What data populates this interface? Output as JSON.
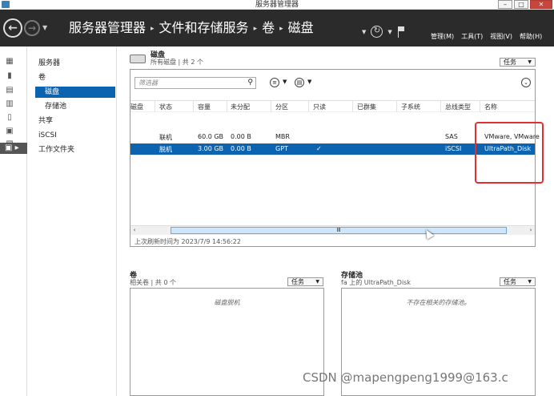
{
  "window": {
    "title": "服务器管理器"
  },
  "header": {
    "breadcrumb": [
      "服务器管理器",
      "文件和存储服务",
      "卷",
      "磁盘"
    ],
    "menus": [
      "管理(M)",
      "工具(T)",
      "视图(V)",
      "帮助(H)"
    ]
  },
  "nav": {
    "items": [
      {
        "label": "服务器"
      },
      {
        "label": "卷"
      },
      {
        "label": "磁盘"
      },
      {
        "label": "存储池"
      },
      {
        "label": "共享"
      },
      {
        "label": "iSCSI"
      },
      {
        "label": "工作文件夹"
      }
    ]
  },
  "disks": {
    "title": "磁盘",
    "subtitle": "所有磁盘 | 共 2 个",
    "tasks_label": "任务",
    "filter_placeholder": "筛选器",
    "columns": [
      "磁盘",
      "状态",
      "容量",
      "未分配",
      "分区",
      "只读",
      "已群集",
      "子系统",
      "总线类型",
      "名称"
    ],
    "rows": [
      {
        "disk": "",
        "status": "联机",
        "capacity": "60.0 GB",
        "unallocated": "0.00 B",
        "partition": "MBR",
        "readonly": "",
        "clustered": "",
        "subsystem": "",
        "bus": "SAS",
        "name": "VMware, VMware"
      },
      {
        "disk": "",
        "status": "脱机",
        "capacity": "3.00 GB",
        "unallocated": "0.00 B",
        "partition": "GPT",
        "readonly": "✓",
        "clustered": "",
        "subsystem": "",
        "bus": "iSCSI",
        "name": "UltraPath_Disk"
      }
    ],
    "scroll_glyph": "Ⅲ",
    "refreshed": "上次刷新时间为 2023/7/9 14:56:22"
  },
  "volumes": {
    "title": "卷",
    "subtitle": "相关卷 | 共 0 个",
    "tasks_label": "任务",
    "empty": "磁盘脱机"
  },
  "pool": {
    "title": "存储池",
    "subtitle": "fa 上的 UltraPath_Disk",
    "tasks_label": "任务",
    "empty": "不存在相关的存储池。"
  },
  "watermark": "CSDN @mapengpeng1999@163.c"
}
